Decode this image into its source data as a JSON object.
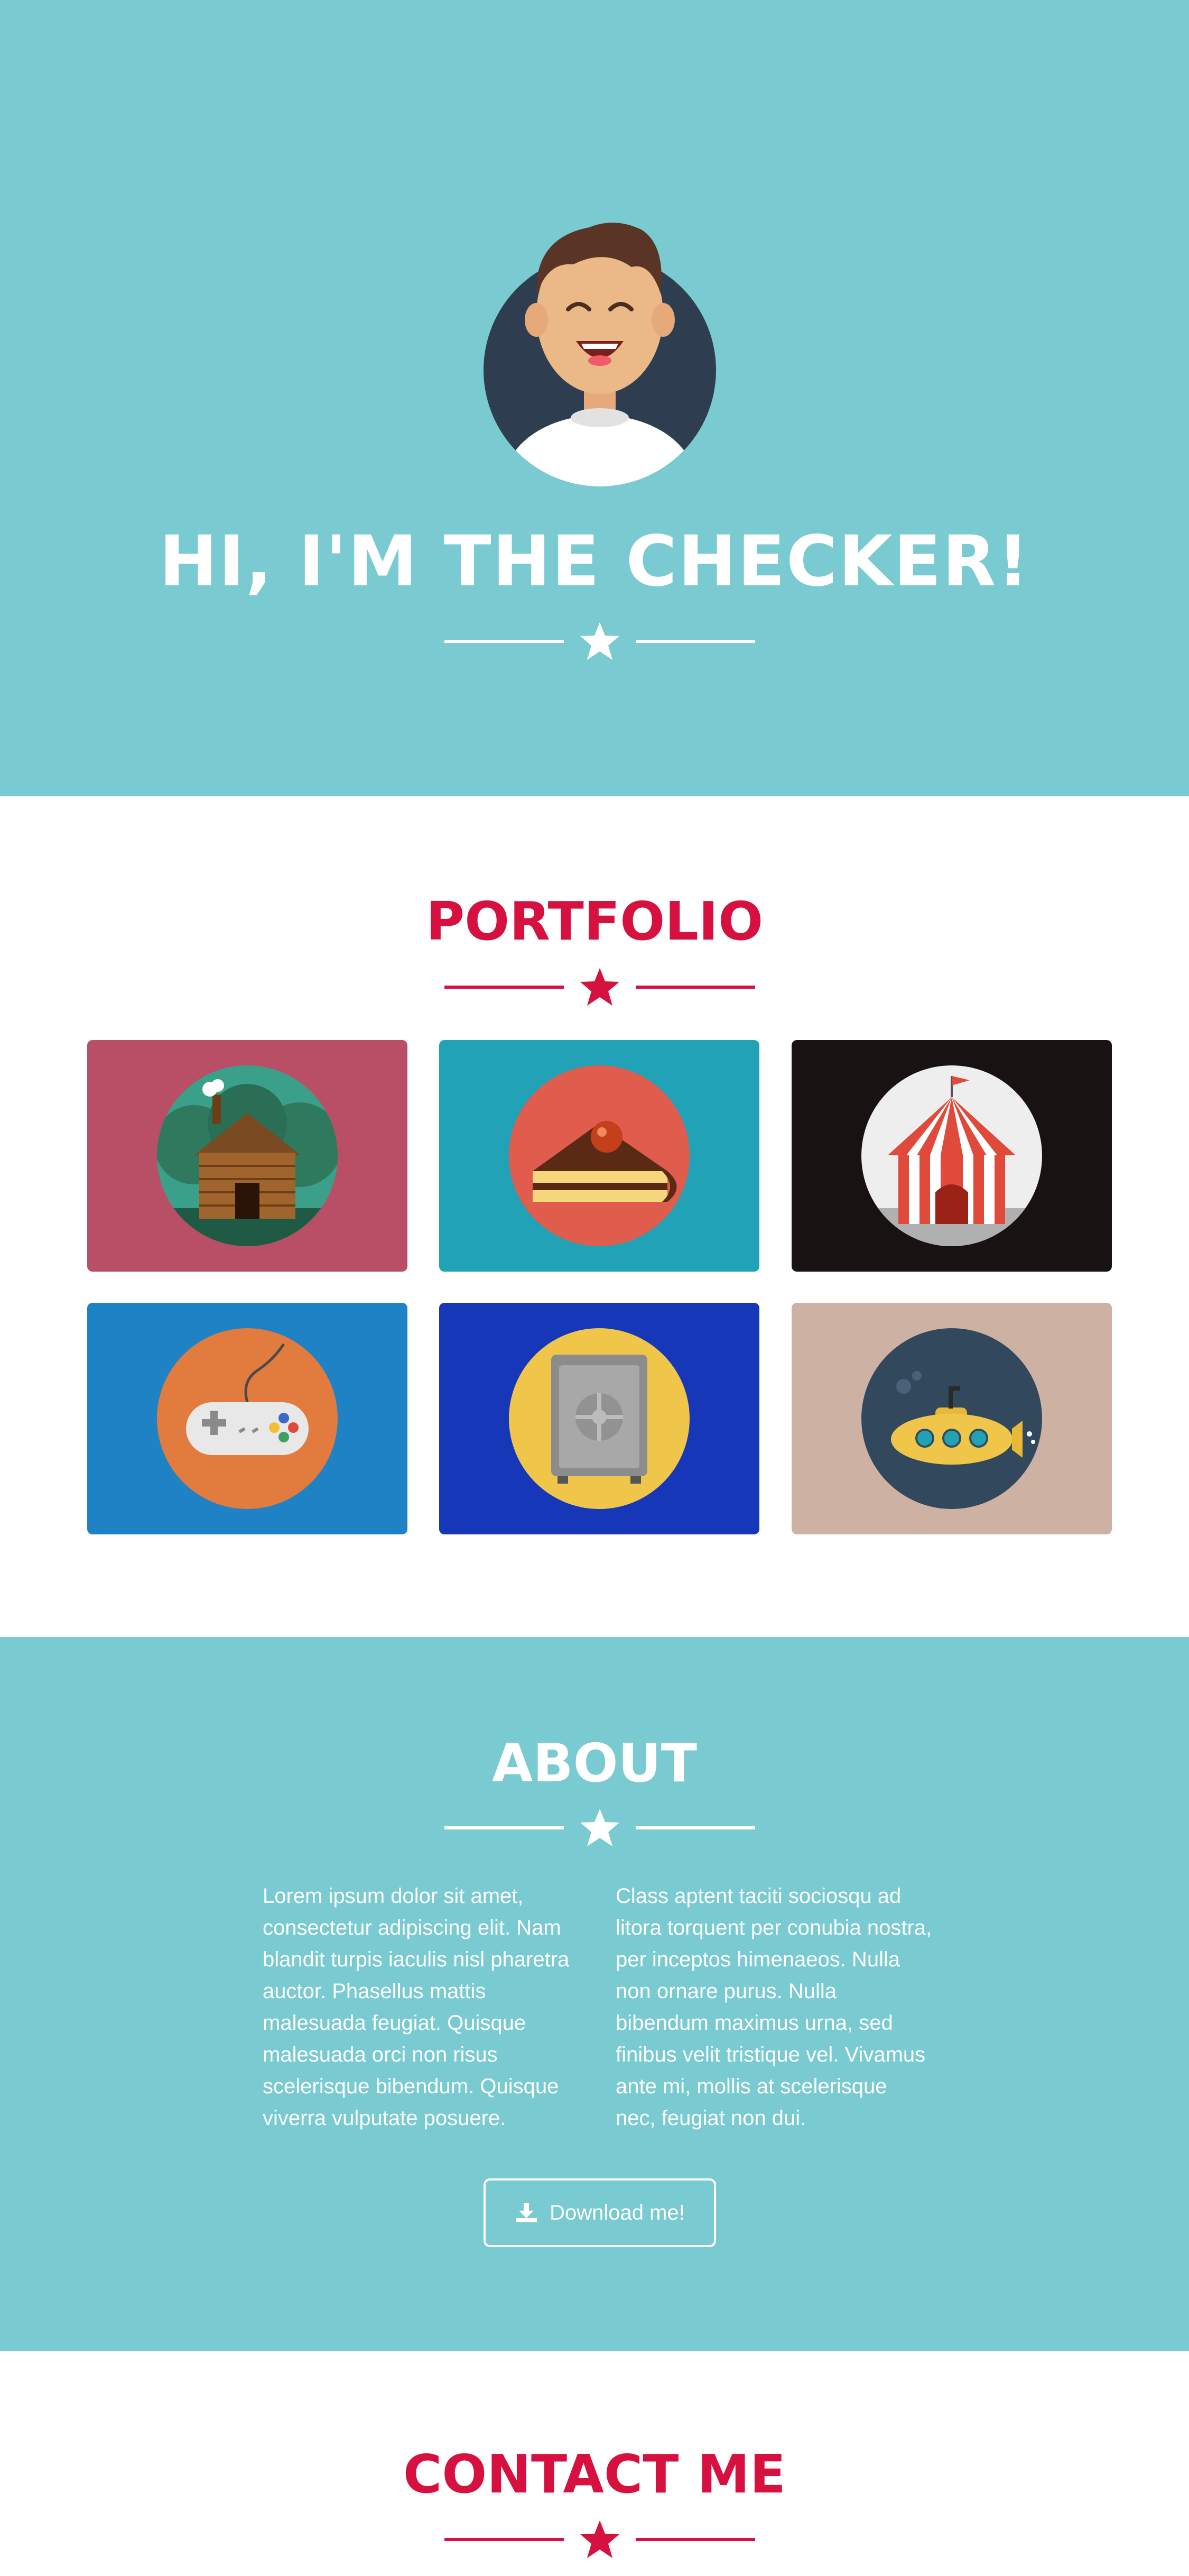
{
  "hero": {
    "title": "HI, I'M THE CHECKER!",
    "avatar_icon": "smiling-man-avatar"
  },
  "portfolio": {
    "title": "PORTFOLIO",
    "items": [
      {
        "icon": "log-cabin-icon",
        "background": "#b94f67"
      },
      {
        "icon": "cake-slice-icon",
        "background": "#21a2b7"
      },
      {
        "icon": "circus-tent-icon",
        "background": "#181212"
      },
      {
        "icon": "game-controller-icon",
        "background": "#1f82c4"
      },
      {
        "icon": "safe-icon",
        "background": "#1637b8"
      },
      {
        "icon": "submarine-icon",
        "background": "#cdb2a4"
      }
    ]
  },
  "about": {
    "title": "ABOUT",
    "col1": "Lorem ipsum dolor sit amet, consectetur adipiscing elit. Nam blandit turpis iaculis nisl pharetra auctor. Phasellus mattis malesuada feugiat. Quisque malesuada orci non risus scelerisque bibendum. Quisque viverra vulputate posuere.",
    "col2": "Class aptent taciti sociosqu ad litora torquent per conubia nostra, per inceptos himenaeos. Nulla non ornare purus. Nulla bibendum maximus urna, sed finibus velit tristique vel. Vivamus ante mi, mollis at scelerisque nec, feugiat non dui.",
    "download_label": "Download me!"
  },
  "contact": {
    "title": "CONTACT ME"
  },
  "colors": {
    "teal": "#79cbd1",
    "accent": "#d6113f",
    "white": "#ffffff"
  }
}
